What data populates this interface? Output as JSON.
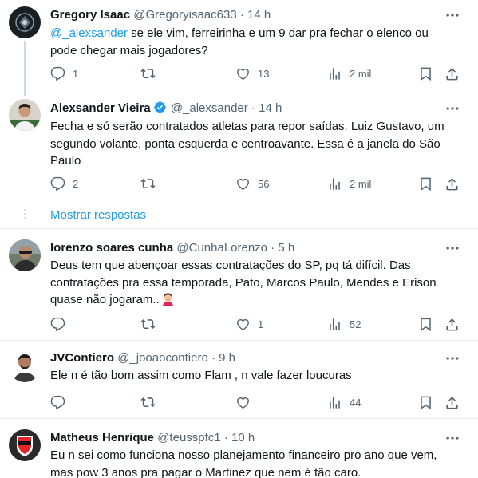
{
  "tweets": [
    {
      "name": "Gregory Isaac",
      "handle": "@Gregoryisaac633",
      "time": "14 h",
      "mention": "@_alexsander",
      "text": " se ele vim, ferreirinha e um 9 dar pra fechar o elenco ou pode chegar mais jogadores?",
      "replies": "1",
      "retweets": "",
      "likes": "13",
      "views": "2 mil",
      "avatar_icon": "dark-logo-avatar"
    },
    {
      "name": "Alexsander Vieira",
      "verified": true,
      "handle": "@_alexsander",
      "time": "14 h",
      "text": "Fecha e só serão contratados atletas para repor saídas. Luiz Gustavo, um segundo volante, ponta esquerda e centroavante. Essa é a janela do São Paulo",
      "replies": "2",
      "retweets": "",
      "likes": "56",
      "views": "2 mil",
      "avatar_icon": "person-photo-avatar"
    },
    {
      "name": "lorenzo soares cunha",
      "handle": "@CunhaLorenzo",
      "time": "5 h",
      "text": "Deus tem que abençoar essas contratações do SP, pq tá difícil. Das contratações pra essa temporada, Pato, Marcos Paulo, Mendes e Erison quase não jogaram..",
      "replies": "",
      "retweets": "",
      "likes": "1",
      "views": "52",
      "avatar_icon": "person-photo-avatar"
    },
    {
      "name": "JVContiero",
      "handle": "@_jooaocontiero",
      "time": "9 h",
      "text": "Ele n é tão bom assim como Flam , n vale fazer loucuras",
      "replies": "",
      "retweets": "",
      "likes": "",
      "views": "44",
      "avatar_icon": "person-photo-avatar"
    },
    {
      "name": "Matheus Henrique",
      "handle": "@teusspfc1",
      "time": "10 h",
      "text": "Eu n sei como funciona nosso planejamento financeiro pro ano que vem, mas pow 3 anos pra pagar o Martinez que nem é tão caro.",
      "avatar_icon": "club-crest-avatar"
    }
  ],
  "show_replies_label": "Mostrar respostas",
  "separator": "·",
  "colors": {
    "link": "#1d9bf0",
    "muted": "#536471",
    "divider": "#eff3f4"
  }
}
